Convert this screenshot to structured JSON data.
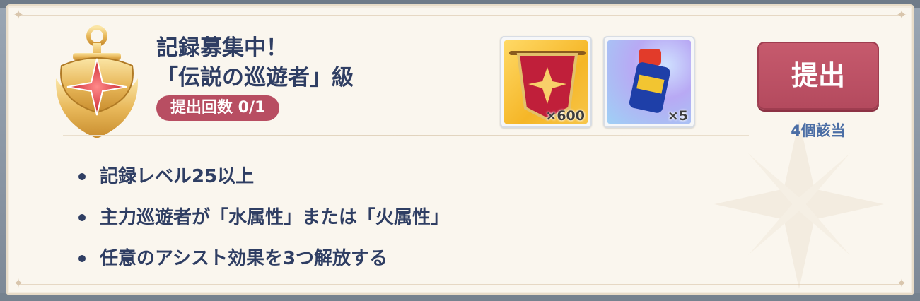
{
  "mission": {
    "title_line1": "記録募集中！",
    "title_line2": "「伝説の巡遊者」級",
    "submit_count": "提出回数 0/1"
  },
  "rewards": [
    {
      "icon": "red-banner-icon",
      "quantity": "×600"
    },
    {
      "icon": "blue-potion-icon",
      "quantity": "×5"
    }
  ],
  "actions": {
    "submit_label": "提出",
    "applicable_text": "4個該当"
  },
  "conditions": [
    "記録レベル25以上",
    "主力巡遊者が「水属性」または「火属性」",
    "任意のアシスト効果を3つ解放する"
  ],
  "colors": {
    "title": "#2f3e63",
    "accent_red": "#b84e62",
    "applicable_blue": "#4b6ea5",
    "card_bg": "#faf6ee"
  }
}
